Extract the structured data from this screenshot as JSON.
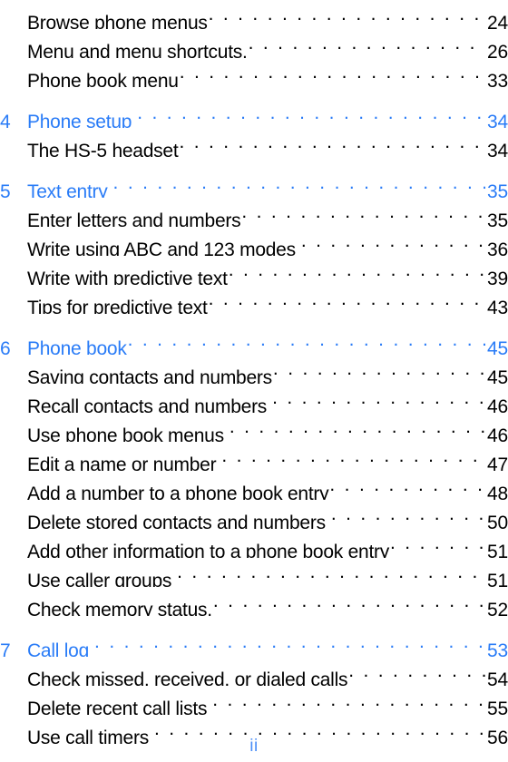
{
  "document": {
    "kind": "table-of-contents",
    "folio": "ii",
    "colors": {
      "chapter_blue": "#2a7cf7",
      "entry_black": "#000000",
      "folio_blue": "#4b8ef7",
      "page_background": "#ffffff"
    }
  },
  "rows": [
    {
      "type": "entry",
      "number": "",
      "title": "Browse phone menus",
      "page": "24",
      "wide_leader_gap": false
    },
    {
      "type": "entry",
      "number": "",
      "title": "Menu and menu shortcuts.",
      "page": "26",
      "wide_leader_gap": false
    },
    {
      "type": "entry",
      "number": "",
      "title": "Phone book menu",
      "page": "33",
      "wide_leader_gap": false
    },
    {
      "type": "chapter",
      "number": "4",
      "title": "Phone setup",
      "page": "34",
      "wide_leader_gap": true
    },
    {
      "type": "entry",
      "number": "",
      "title": "The HS-5 headset",
      "page": "34",
      "wide_leader_gap": false
    },
    {
      "type": "chapter",
      "number": "5",
      "title": "Text entry",
      "page": "35",
      "wide_leader_gap": true
    },
    {
      "type": "entry",
      "number": "",
      "title": "Enter letters and numbers",
      "page": "35",
      "wide_leader_gap": false
    },
    {
      "type": "entry",
      "number": "",
      "title": "Write using ABC and 123 modes",
      "page": "36",
      "wide_leader_gap": true
    },
    {
      "type": "entry",
      "number": "",
      "title": "Write with predictive text",
      "page": "39",
      "wide_leader_gap": false
    },
    {
      "type": "entry",
      "number": "",
      "title": "Tips for predictive text",
      "page": "43",
      "wide_leader_gap": false
    },
    {
      "type": "chapter",
      "number": "6",
      "title": "Phone book",
      "page": "45",
      "wide_leader_gap": false
    },
    {
      "type": "entry",
      "number": "",
      "title": "Saving contacts and numbers",
      "page": "45",
      "wide_leader_gap": false
    },
    {
      "type": "entry",
      "number": "",
      "title": "Recall contacts and numbers",
      "page": "46",
      "wide_leader_gap": true
    },
    {
      "type": "entry",
      "number": "",
      "title": "Use phone book menus",
      "page": "46",
      "wide_leader_gap": true
    },
    {
      "type": "entry",
      "number": "",
      "title": "Edit a name or number",
      "page": "47",
      "wide_leader_gap": true
    },
    {
      "type": "entry",
      "number": "",
      "title": "Add a number to a phone book entry",
      "page": "48",
      "wide_leader_gap": false
    },
    {
      "type": "entry",
      "number": "",
      "title": "Delete stored contacts and numbers",
      "page": "50",
      "wide_leader_gap": true
    },
    {
      "type": "entry",
      "number": "",
      "title": "Add other information to a phone book entry",
      "page": "51",
      "wide_leader_gap": false
    },
    {
      "type": "entry",
      "number": "",
      "title": "Use caller groups",
      "page": "51",
      "wide_leader_gap": true
    },
    {
      "type": "entry",
      "number": "",
      "title": "Check memory status.",
      "page": "52",
      "wide_leader_gap": false
    },
    {
      "type": "chapter",
      "number": "7",
      "title": "Call log",
      "page": "53",
      "wide_leader_gap": true
    },
    {
      "type": "entry",
      "number": "",
      "title": "Check missed, received, or dialed calls",
      "page": "54",
      "wide_leader_gap": false
    },
    {
      "type": "entry",
      "number": "",
      "title": "Delete recent call lists",
      "page": "55",
      "wide_leader_gap": true
    },
    {
      "type": "entry",
      "number": "",
      "title": "Use call timers",
      "page": "56",
      "wide_leader_gap": true
    }
  ]
}
